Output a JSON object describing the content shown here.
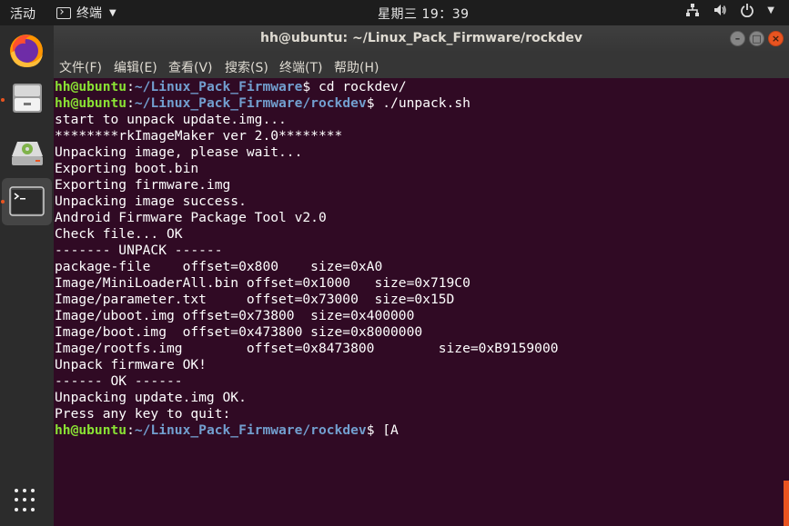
{
  "topbar": {
    "activities": "活动",
    "app_name": "终端",
    "clock": "星期三 19：39"
  },
  "window": {
    "title": "hh@ubuntu: ~/Linux_Pack_Firmware/rockdev"
  },
  "menu": [
    "文件(F)",
    "编辑(E)",
    "查看(V)",
    "搜索(S)",
    "终端(T)",
    "帮助(H)"
  ],
  "terminal": {
    "lines": [
      {
        "user": "hh@ubuntu",
        "path": "~/Linux_Pack_Firmware",
        "cmd": "$ cd rockdev/"
      },
      {
        "user": "hh@ubuntu",
        "path": "~/Linux_Pack_Firmware/rockdev",
        "cmd": "$ ./unpack.sh"
      },
      {
        "text": "start to unpack update.img..."
      },
      {
        "text": "********rkImageMaker ver 2.0********"
      },
      {
        "text": "Unpacking image, please wait..."
      },
      {
        "text": "Exporting boot.bin"
      },
      {
        "text": "Exporting firmware.img"
      },
      {
        "text": "Unpacking image success."
      },
      {
        "text": "Android Firmware Package Tool v2.0"
      },
      {
        "text": "Check file... OK"
      },
      {
        "text": "------- UNPACK ------"
      },
      {
        "text": "package-file    offset=0x800    size=0xA0"
      },
      {
        "text": "Image/MiniLoaderAll.bin offset=0x1000   size=0x719C0"
      },
      {
        "text": "Image/parameter.txt     offset=0x73000  size=0x15D"
      },
      {
        "text": "Image/uboot.img offset=0x73800  size=0x400000"
      },
      {
        "text": "Image/boot.img  offset=0x473800 size=0x8000000"
      },
      {
        "text": "Image/rootfs.img        offset=0x8473800        size=0xB9159000"
      },
      {
        "text": "Unpack firmware OK!"
      },
      {
        "text": "------ OK ------"
      },
      {
        "text": "Unpacking update.img OK."
      },
      {
        "text": "Press any key to quit:"
      },
      {
        "user": "hh@ubuntu",
        "path": "~/Linux_Pack_Firmware/rockdev",
        "cmd": "$ [A"
      }
    ]
  },
  "colors": {
    "terminal_bg": "#300a24",
    "prompt_user": "#8ae234",
    "prompt_path": "#729fcf",
    "accent": "#e95420"
  },
  "dock": {
    "items": [
      "firefox-icon",
      "files-icon",
      "disk-icon",
      "terminal-icon"
    ],
    "show_apps": "apps-grid-icon"
  }
}
